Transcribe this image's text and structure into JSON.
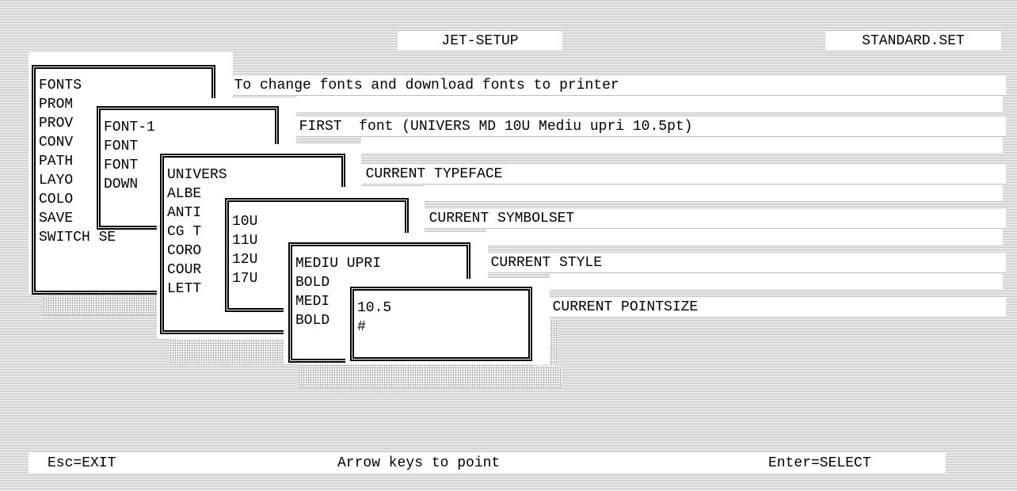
{
  "header": {
    "title": "JET-SETUP",
    "file": "STANDARD.SET"
  },
  "menu_main": {
    "items": [
      "FONTS",
      "PROM",
      "PROV",
      "CONV",
      "PATH",
      "LAYO",
      "COLO",
      "SAVE",
      "SWITCH SE"
    ],
    "hint": "< To change fonts and download fonts to printer"
  },
  "menu_fonts": {
    "items": [
      "FONT-1",
      "FONT",
      "FONT",
      "DOWN"
    ],
    "hint": "< FIRST  font (UNIVERS MD 10U Mediu upri 10.5pt)"
  },
  "menu_typeface": {
    "items": [
      "UNIVERS",
      "ALBE",
      "ANTI",
      "CG T",
      "CORO",
      "COUR",
      "LETT"
    ],
    "hint": "< CURRENT TYPEFACE"
  },
  "menu_symbolset": {
    "items": [
      "10U",
      "11U",
      "12U",
      "17U"
    ],
    "hint": "< CURRENT SYMBOLSET"
  },
  "menu_style": {
    "items": [
      "MEDIU UPRI",
      "BOLD",
      "MEDI",
      "BOLD"
    ],
    "hint": "< CURRENT STYLE"
  },
  "menu_pointsize": {
    "items": [
      "10.5",
      "#"
    ],
    "hint": "< CURRENT POINTSIZE"
  },
  "footer": {
    "exit": "Esc=EXIT",
    "center": "Arrow keys to point",
    "select": "Enter=SELECT"
  }
}
